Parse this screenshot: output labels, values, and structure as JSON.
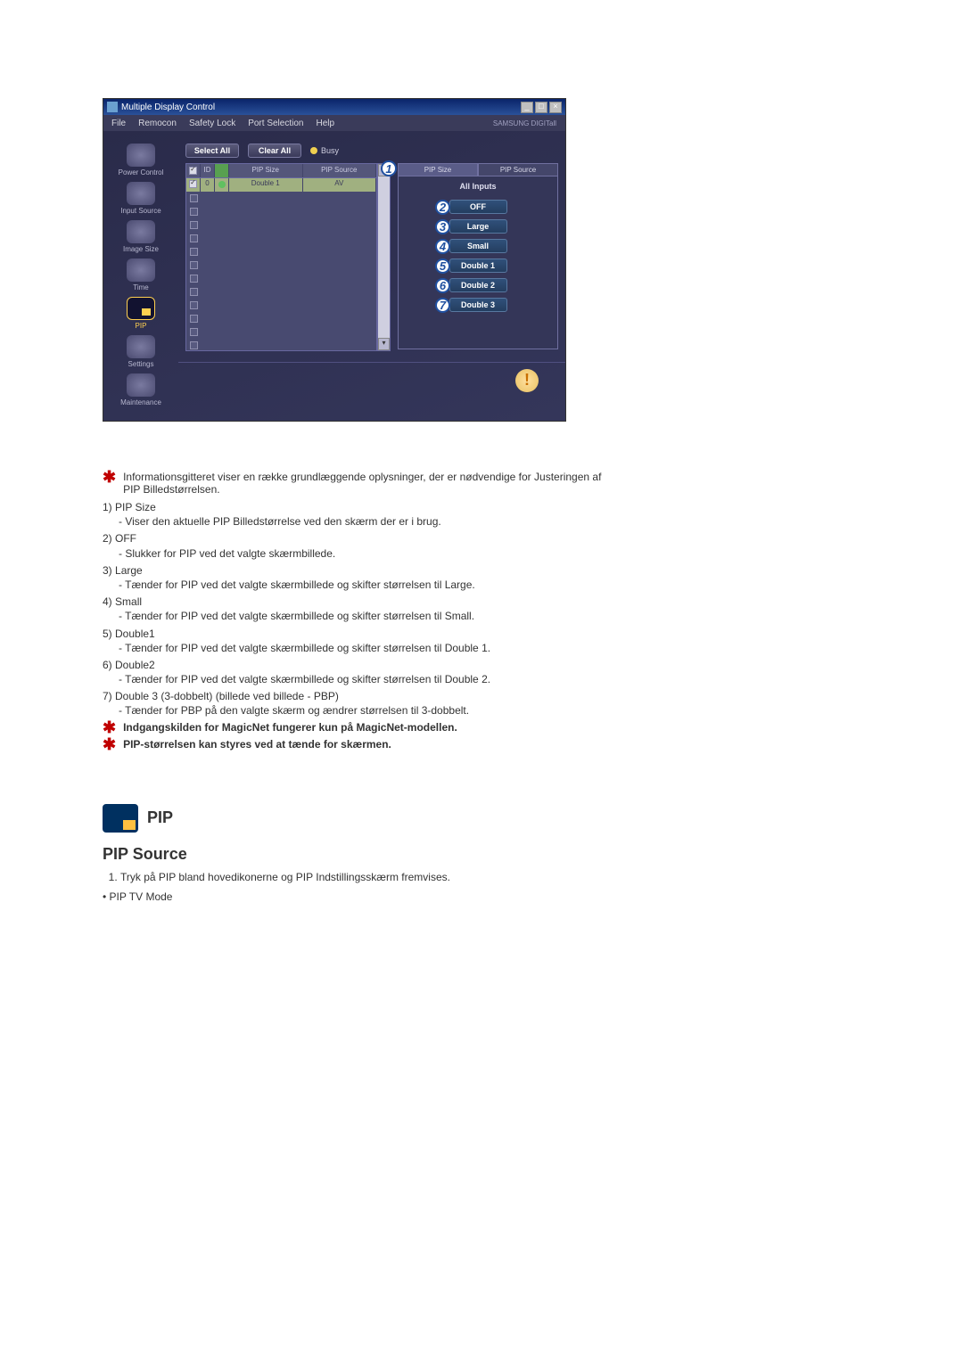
{
  "app": {
    "title": "Multiple Display Control",
    "brand": "SAMSUNG DIGITall"
  },
  "menu": [
    "File",
    "Remocon",
    "Safety Lock",
    "Port Selection",
    "Help"
  ],
  "sidebar": [
    {
      "label": "Power Control"
    },
    {
      "label": "Input Source"
    },
    {
      "label": "Image Size"
    },
    {
      "label": "Time"
    },
    {
      "label": "PIP"
    },
    {
      "label": "Settings"
    },
    {
      "label": "Maintenance"
    }
  ],
  "toolbar": {
    "selectAll": "Select All",
    "clearAll": "Clear All",
    "busy": "Busy"
  },
  "grid": {
    "headers": {
      "id": "ID",
      "pipSize": "PIP Size",
      "pipSource": "PIP Source"
    },
    "row": {
      "id": "0",
      "pipSize": "Double 1",
      "pipSource": "AV"
    }
  },
  "rightPanel": {
    "tabSize": "PIP Size",
    "tabSource": "PIP Source",
    "allInputs": "All Inputs",
    "options": [
      "OFF",
      "Large",
      "Small",
      "Double 1",
      "Double 2",
      "Double 3"
    ]
  },
  "callouts": [
    "1",
    "2",
    "3",
    "4",
    "5",
    "6",
    "7"
  ],
  "explain": {
    "intro": "Informationsgitteret viser en række grundlæggende oplysninger, der er nødvendige for Justeringen af PIP Billedstørrelsen.",
    "items": [
      {
        "num": "1)",
        "title": "PIP Size",
        "desc": "- Viser den aktuelle PIP Billedstørrelse ved den skærm der er i brug."
      },
      {
        "num": "2)",
        "title": "OFF",
        "desc": "- Slukker for PIP ved det valgte skærmbillede."
      },
      {
        "num": "3)",
        "title": "Large",
        "desc": "- Tænder for PIP ved det valgte skærmbillede og skifter størrelsen til Large."
      },
      {
        "num": "4)",
        "title": "Small",
        "desc": "- Tænder for PIP ved det valgte skærmbillede og skifter størrelsen til Small."
      },
      {
        "num": "5)",
        "title": "Double1",
        "desc": "- Tænder for PIP ved det valgte skærmbillede og skifter størrelsen til Double 1."
      },
      {
        "num": "6)",
        "title": "Double2",
        "desc": "- Tænder for PIP ved det valgte skærmbillede og skifter størrelsen til Double 2."
      },
      {
        "num": "7)",
        "title": "Double 3 (3-dobbelt) (billede ved billede - PBP)",
        "desc": "- Tænder for PBP på den valgte skærm og ændrer størrelsen til 3-dobbelt."
      }
    ],
    "notes": [
      "Indgangskilden for MagicNet fungerer kun på MagicNet-modellen.",
      "PIP-størrelsen kan styres ved at tænde for skærmen."
    ]
  },
  "section2": {
    "iconLabel": "PIP",
    "title": "PIP Source",
    "step1": "Tryk på PIP bland hovedikonerne og PIP Indstillingsskærm fremvises.",
    "bullet": "PIP TV Mode"
  }
}
